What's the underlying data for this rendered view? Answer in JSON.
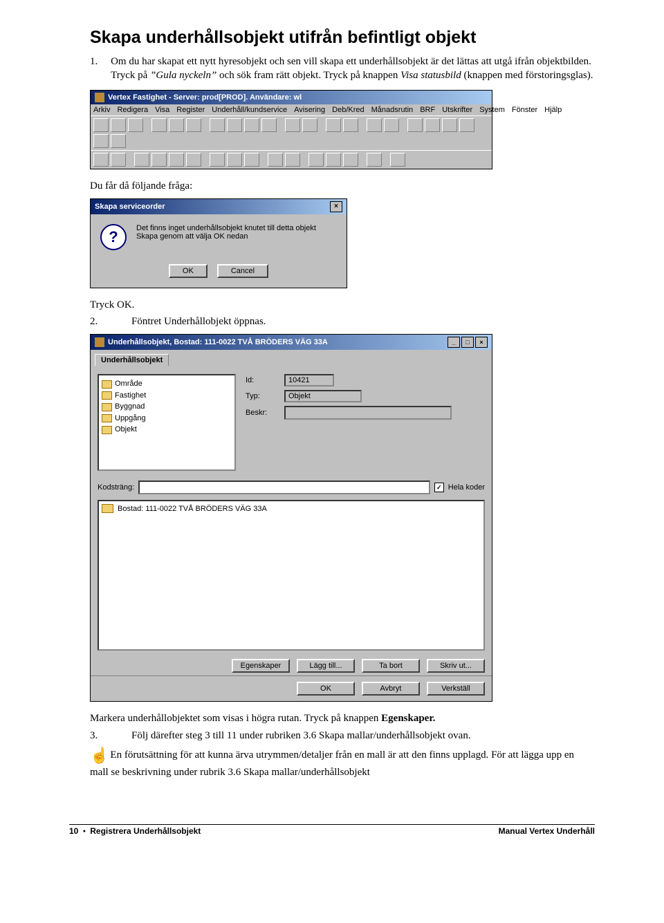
{
  "heading": "Skapa underhållsobjekt utifrån befintligt objekt",
  "p1": {
    "num": "1.",
    "text_a": "Om du har skapat ett nytt hyresobjekt och sen vill skapa ett underhållsobjekt är det lättas att utgå ifrån objektbilden. Tryck på ",
    "gula": "”Gula nyckeln”",
    "text_b": " och sök fram rätt objekt. Tryck på knappen ",
    "visa": "Visa statusbild",
    "text_c": " (knappen med förstoringsglas)."
  },
  "toolbar": {
    "title": "Vertex Fastighet - Server: prod[PROD]. Användare: wl",
    "menus": [
      "Arkiv",
      "Redigera",
      "Visa",
      "Register",
      "Underhåll/kundservice",
      "Avisering",
      "Deb/Kred",
      "Månadsrutin",
      "BRF",
      "Utskrifter",
      "System",
      "Fönster",
      "Hjälp"
    ]
  },
  "p_after_toolbar": "Du får då följande fråga:",
  "dialog": {
    "title": "Skapa serviceorder",
    "line1": "Det finns inget underhållsobjekt knutet till detta objekt",
    "line2": "Skapa genom att välja OK nedan",
    "ok": "OK",
    "cancel": "Cancel"
  },
  "p_tryck_ok": "Tryck OK.",
  "p2": {
    "num": "2.",
    "text": "Föntret Underhållobjekt öppnas."
  },
  "objwin": {
    "title": "Underhållsobjekt, Bostad: 111-0022 TVÅ BRÖDERS VÄG  33A",
    "tab": "Underhållsobjekt",
    "tree": [
      "Område",
      "Fastighet",
      "Byggnad",
      "Uppgång",
      "Objekt"
    ],
    "id_lbl": "Id:",
    "id_val": "10421",
    "typ_lbl": "Typ:",
    "typ_val": "Objekt",
    "beskr_lbl": "Beskr:",
    "kod_lbl": "Kodsträng:",
    "hela_lbl": "Hela koder",
    "list_item": "Bostad: 111-0022 TVÅ BRÖDERS VÄG  33A",
    "btns1": [
      "Egenskaper",
      "Lägg till...",
      "Ta bort",
      "Skriv ut..."
    ],
    "btns2": [
      "OK",
      "Avbryt",
      "Verkställ"
    ]
  },
  "p_after_objwin": {
    "a": "Markera underhållobjektet som visas i högra rutan. Tryck på knappen ",
    "b": "Egenskaper."
  },
  "p3": {
    "num": "3.",
    "text": "Följ därefter steg 3 till 11 under rubriken 3.6 Skapa mallar/underhållsobjekt ovan."
  },
  "p_hand": "En förutsättning för att kunna ärva utrymmen/detaljer från en mall är att den finns upplagd. För att lägga upp en mall se beskrivning under rubrik 3.6 Skapa mallar/underhållsobjekt",
  "footer": {
    "left_a": "10 ",
    "left_b": " Registrera Underhållsobjekt",
    "right": "Manual Vertex Underhåll"
  }
}
